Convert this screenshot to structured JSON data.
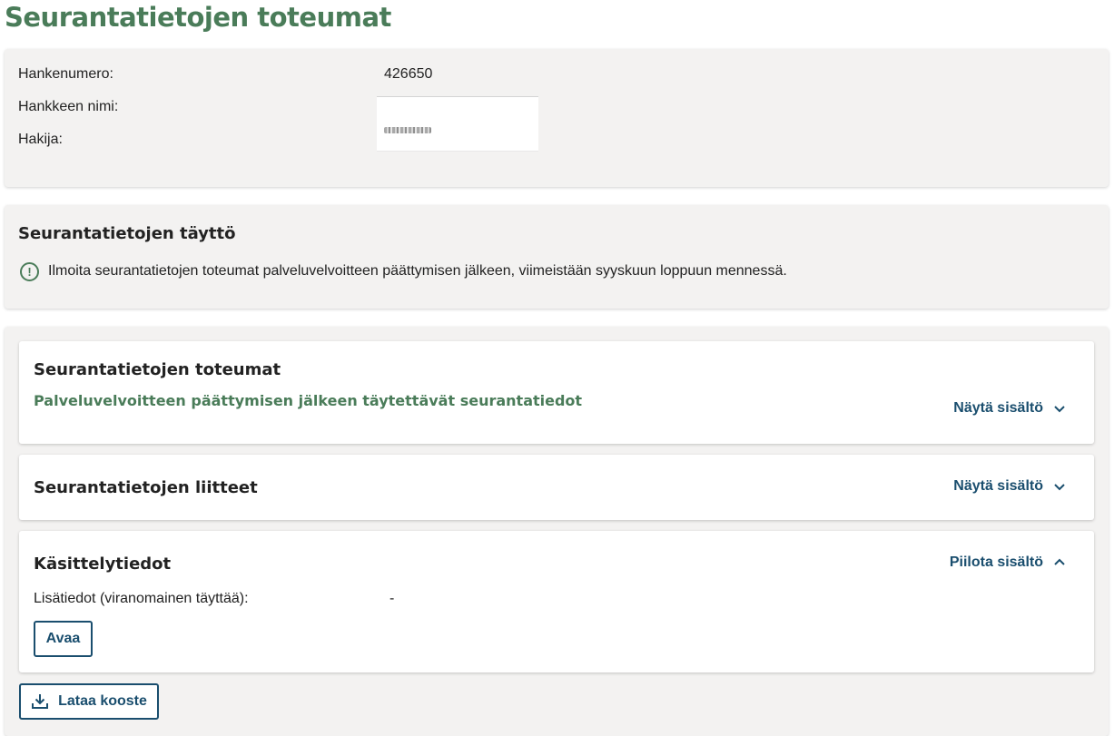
{
  "page": {
    "title": "Seurantatietojen toteumat"
  },
  "info": {
    "project_number_label": "Hankenumero:",
    "project_number_value": "426650",
    "project_name_label": "Hankkeen nimi:",
    "applicant_label": "Hakija:"
  },
  "notice": {
    "title": "Seurantatietojen täyttö",
    "icon": "exclamation-circle-icon",
    "text": "Ilmoita seurantatietojen toteumat palveluvelvoitteen päättymisen jälkeen, viimeistään syyskuun loppuun mennessä."
  },
  "sections": [
    {
      "title": "Seurantatietojen toteumat",
      "subtitle": "Palveluvelvoitteen päättymisen jälkeen täytettävät seurantatiedot",
      "toggle_label": "Näytä sisältö",
      "toggle_icon": "chevron-down-icon"
    },
    {
      "title": "Seurantatietojen liitteet",
      "toggle_label": "Näytä sisältö",
      "toggle_icon": "chevron-down-icon"
    },
    {
      "title": "Käsittelytiedot",
      "toggle_label": "Piilota sisältö",
      "toggle_icon": "chevron-up-icon",
      "detail_label": "Lisätiedot (viranomainen täyttää):",
      "detail_value": "-",
      "open_button": "Avaa"
    }
  ],
  "actions": {
    "download_label": "Lataa kooste",
    "download_icon": "download-icon"
  },
  "colors": {
    "heading_green": "#4a7c59",
    "link_blue": "#1a4e6e",
    "card_bg": "#f3f2f1"
  }
}
